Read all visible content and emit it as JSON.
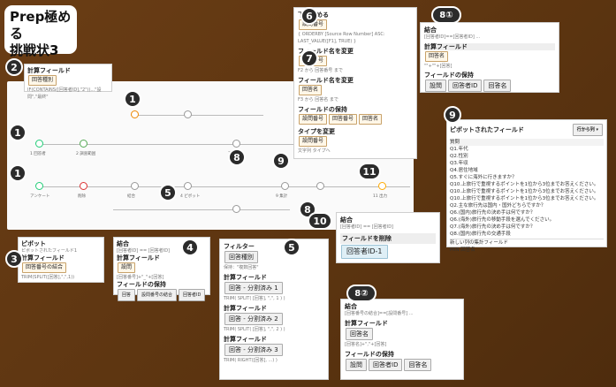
{
  "title": "Prep極める\n挑戦状3",
  "badges": [
    "1",
    "1",
    "1",
    "1",
    "2",
    "3",
    "4",
    "5",
    "5",
    "6",
    "7",
    "8",
    "8",
    "9",
    "9",
    "10",
    "11",
    "8①",
    "8②"
  ],
  "flow": {
    "nodes": [
      "1 回答者",
      "2 調査範囲",
      "回答",
      "削除",
      "4 ピボット",
      "5 データ型",
      "6 ピボット",
      "整理",
      "7 結合",
      "8 結合",
      "9 集計",
      "11 出力",
      "アンケート",
      "ピボット",
      "計算",
      "結合",
      "ピボット",
      "名前変更",
      "フィルター"
    ]
  },
  "panel2": {
    "title": "計算フィールド",
    "chip": "回答種別",
    "formula": "IF(CONTAINS([回答者ID],\"2\"))...\"設問\",\"最終\""
  },
  "panel3": {
    "t1": "ピボット",
    "s1": "ピボットされたフィールド1",
    "t2": "計算フィールド",
    "chip": "回答番号の結合",
    "f": "TRIM(SPLIT([回答],\",\",1))"
  },
  "panel4": {
    "t1": "結合",
    "s1": "[回答者ID] == [回答者ID]",
    "t2": "計算フィールド",
    "chip": "設問",
    "f": "[回答番号]+\"_\"+[回答]",
    "t3": "フィールドの保持",
    "keep": [
      "回答",
      "設問番号の結合",
      "回答者ID"
    ]
  },
  "panel5": {
    "t1": "フィルター",
    "chip1": "回答種別",
    "s1": "保持：\"複数回答\"",
    "calc": [
      {
        "t": "計算フィールド",
        "chip": "回答 - 分割済み 1",
        "f": "TRIM( SPLIT( [回答], \",\", 1 ) )"
      },
      {
        "t": "計算フィールド",
        "chip": "回答 - 分割済み 2",
        "f": "TRIM( SPLIT( [回答], \",\", 2 ) )"
      },
      {
        "t": "計算フィールド",
        "chip": "回答 - 分割済み 3",
        "f": "TRIM( RIGHT([回答], ...) )"
      }
    ]
  },
  "panel6": {
    "t1": "下を埋める",
    "chip1": "設問番号",
    "f1": "{ ORDERBY [Source Row Number] ASC: LAST_VALUE([F1], TRUE) }",
    "t2": "フィールド名を変更",
    "chip2": "設問番号",
    "s2": "F2 から 回答番号 まで",
    "t3": "フィールド名を変更",
    "chip3": "回答名",
    "s3": "F3 から 回答名 まで",
    "t4": "フィールドの保持",
    "keep": [
      "設問番号",
      "回答番号",
      "回答名"
    ],
    "t5": "タイプを変更",
    "chip5": "設問番号",
    "s5": "文字列 タイプへ"
  },
  "panel81": {
    "t1": "結合",
    "s1": "[回答者ID]==[回答者ID] ...",
    "t2": "計算フィールド",
    "chip": "回答名",
    "f": "\"\"+\"\"+[回答]",
    "t3": "フィールドの保持",
    "keep": [
      "設問",
      "回答者ID",
      "回答名"
    ]
  },
  "panel82": {
    "t1": "結合",
    "s1": "[回答番号の結合]==[設問番号] ...",
    "t2": "計算フィールド",
    "chip": "回答名",
    "f": "[回答名]+\",\"+[回答]",
    "t3": "フィールドの保持",
    "keep": [
      "設問",
      "回答者ID",
      "回答名"
    ]
  },
  "panel9": {
    "title": "ピボットされたフィールド",
    "btn": "行から列 ▾",
    "col": "質問",
    "rows": [
      "Q1.年代",
      "Q2.性別",
      "Q3.年収",
      "Q4.居住地域",
      "Q5.すぐに海外に行きますか？",
      "Q10.上旅行で重視するポイントを1位から3位までお答えください。",
      "Q10.上旅行で重視するポイントを1位から3位までお答えください。",
      "Q10.上旅行で重視するポイントを1位から3位までお答えください。",
      "Q2.主な旅行先は国内・国外どちらですか？",
      "Q6.(国内)旅行先の決め手は何ですか？",
      "Q6.(海外)旅行先の移動手段を選んでください。",
      "Q7.(海外)旅行先の決め手は何ですか？",
      "Q8.(国内)旅行先の交通手段"
    ],
    "footer": "新しい列の集計フィールド",
    "agg": "MIN",
    "field": "回答名"
  },
  "panel10": {
    "t1": "結合",
    "s1": "[回答者ID] == [回答者ID]",
    "t2": "フィールドを削除",
    "chip": "回答者ID-1"
  }
}
